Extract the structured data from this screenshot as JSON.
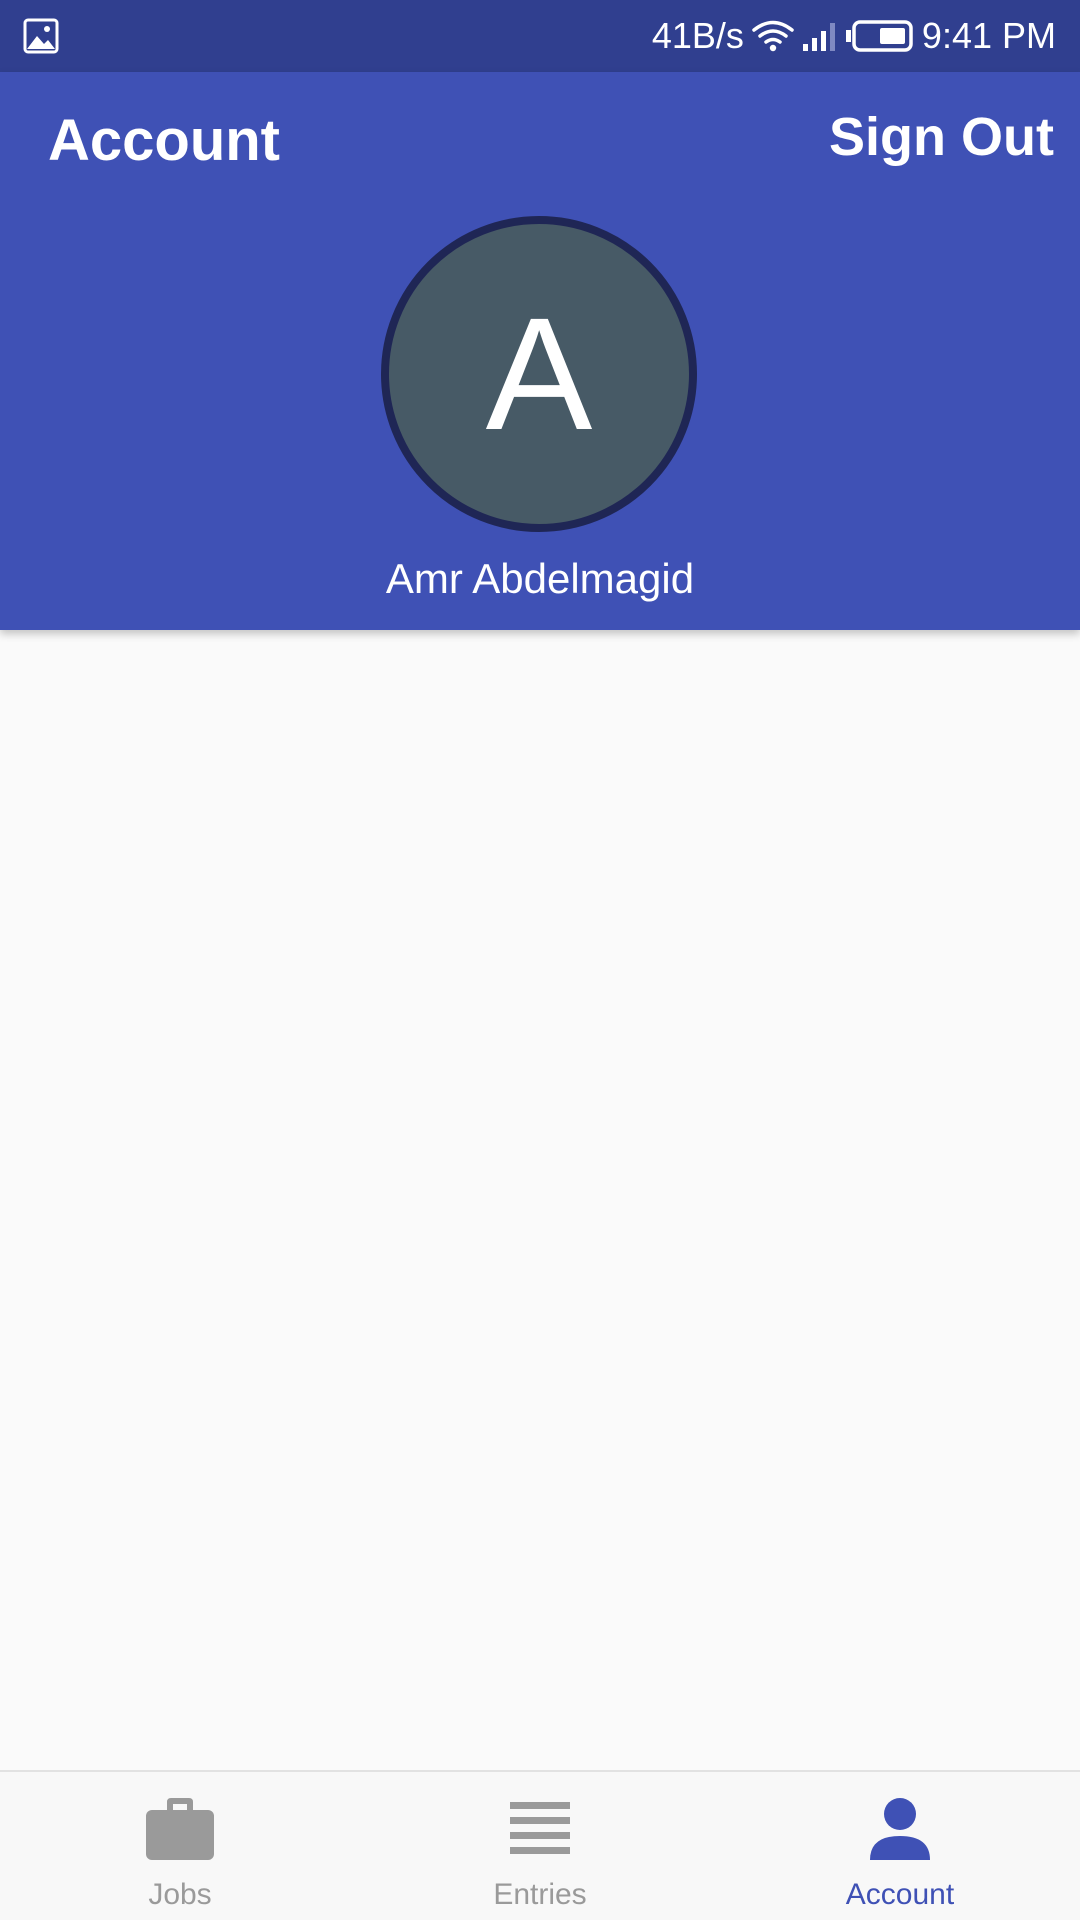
{
  "status_bar": {
    "net_speed": "41B/s",
    "time": "9:41 PM",
    "icons": [
      "gallery-notification-icon",
      "wifi-icon",
      "signal-icon",
      "battery-icon"
    ]
  },
  "header": {
    "title": "Account",
    "sign_out_label": "Sign Out",
    "avatar_initial": "A",
    "user_name": "Amr Abdelmagid"
  },
  "bottom_nav": {
    "items": [
      {
        "label": "Jobs",
        "icon": "briefcase-icon",
        "active": false
      },
      {
        "label": "Entries",
        "icon": "list-icon",
        "active": false
      },
      {
        "label": "Account",
        "icon": "person-icon",
        "active": true
      }
    ]
  },
  "colors": {
    "status_bar": "#303f8f",
    "primary": "#3f51b5",
    "avatar_bg": "#475a66",
    "avatar_border": "#1f2655",
    "inactive": "#9a9a9a",
    "background": "#fafafa"
  }
}
